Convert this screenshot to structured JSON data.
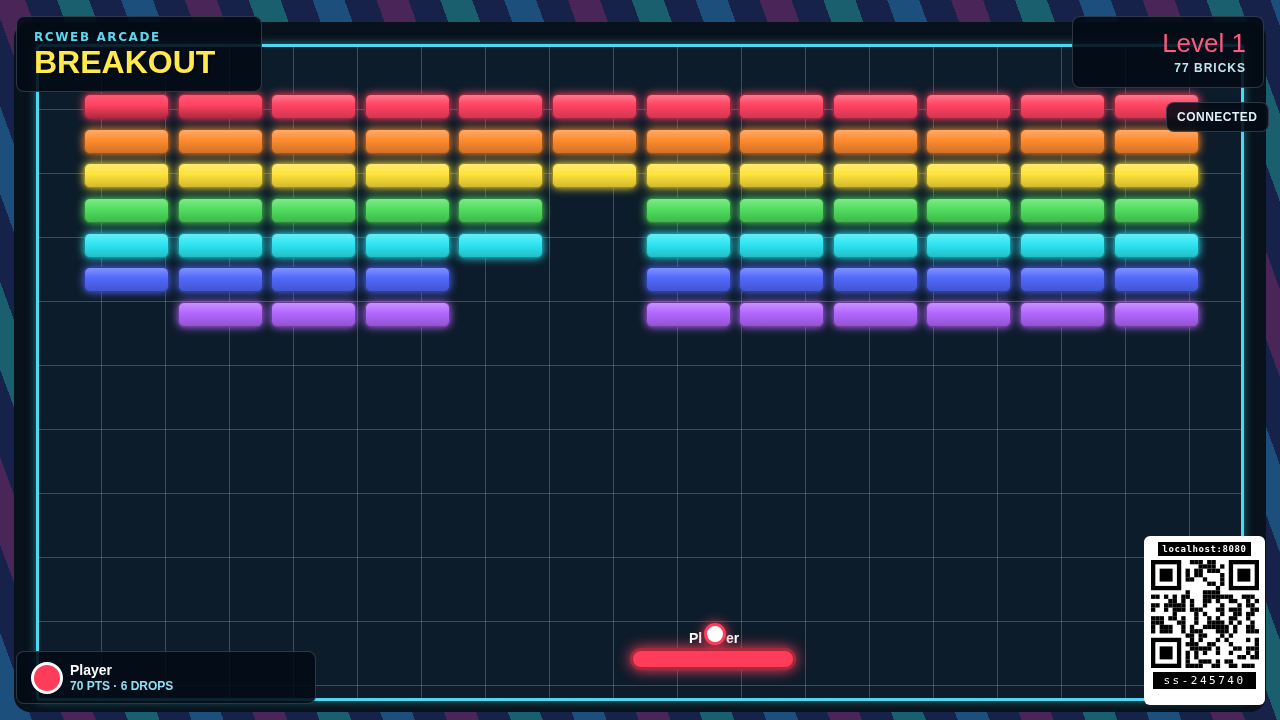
{
  "header": {
    "brand": "RCWEB ARCADE",
    "title": "BREAKOUT"
  },
  "level": {
    "label": "Level 1",
    "count": "77 BRICKS"
  },
  "connection": {
    "label": "CONNECTED"
  },
  "brick_rows": [
    {
      "color": "#ff4262",
      "bricks": [
        {
          "present": true,
          "damaged": true
        },
        {
          "present": true,
          "damaged": true
        },
        {
          "present": true,
          "damaged": false
        },
        {
          "present": true,
          "damaged": false
        },
        {
          "present": true,
          "damaged": false
        },
        {
          "present": true,
          "damaged": false
        },
        {
          "present": true,
          "damaged": false
        },
        {
          "present": true,
          "damaged": false
        },
        {
          "present": true,
          "damaged": false
        },
        {
          "present": true,
          "damaged": false
        },
        {
          "present": true,
          "damaged": false
        },
        {
          "present": true,
          "damaged": false
        }
      ]
    },
    {
      "color": "#ff8a2e",
      "bricks": [
        {
          "present": true,
          "damaged": false
        },
        {
          "present": true,
          "damaged": false
        },
        {
          "present": true,
          "damaged": false
        },
        {
          "present": true,
          "damaged": false
        },
        {
          "present": true,
          "damaged": false
        },
        {
          "present": true,
          "damaged": false
        },
        {
          "present": true,
          "damaged": false
        },
        {
          "present": true,
          "damaged": false
        },
        {
          "present": true,
          "damaged": false
        },
        {
          "present": true,
          "damaged": false
        },
        {
          "present": true,
          "damaged": false
        },
        {
          "present": true,
          "damaged": false
        }
      ]
    },
    {
      "color": "#ffe23a",
      "bricks": [
        {
          "present": true,
          "damaged": false
        },
        {
          "present": true,
          "damaged": false
        },
        {
          "present": true,
          "damaged": false
        },
        {
          "present": true,
          "damaged": false
        },
        {
          "present": true,
          "damaged": false
        },
        {
          "present": true,
          "damaged": false
        },
        {
          "present": true,
          "damaged": false
        },
        {
          "present": true,
          "damaged": false
        },
        {
          "present": true,
          "damaged": false
        },
        {
          "present": true,
          "damaged": false
        },
        {
          "present": true,
          "damaged": false
        },
        {
          "present": true,
          "damaged": false
        }
      ]
    },
    {
      "color": "#4fde5e",
      "bricks": [
        {
          "present": true,
          "damaged": false
        },
        {
          "present": true,
          "damaged": false
        },
        {
          "present": true,
          "damaged": false
        },
        {
          "present": true,
          "damaged": false
        },
        {
          "present": true,
          "damaged": false
        },
        {
          "present": false
        },
        {
          "present": true,
          "damaged": false
        },
        {
          "present": true,
          "damaged": false
        },
        {
          "present": true,
          "damaged": false
        },
        {
          "present": true,
          "damaged": false
        },
        {
          "present": true,
          "damaged": false
        },
        {
          "present": true,
          "damaged": false
        }
      ]
    },
    {
      "color": "#2ce6f2",
      "bricks": [
        {
          "present": true,
          "damaged": false
        },
        {
          "present": true,
          "damaged": false
        },
        {
          "present": true,
          "damaged": false
        },
        {
          "present": true,
          "damaged": false
        },
        {
          "present": true,
          "damaged": false
        },
        {
          "present": false
        },
        {
          "present": true,
          "damaged": false
        },
        {
          "present": true,
          "damaged": false
        },
        {
          "present": true,
          "damaged": false
        },
        {
          "present": true,
          "damaged": false
        },
        {
          "present": true,
          "damaged": false
        },
        {
          "present": true,
          "damaged": false
        }
      ]
    },
    {
      "color": "#5068fc",
      "bricks": [
        {
          "present": true,
          "damaged": false
        },
        {
          "present": true,
          "damaged": false
        },
        {
          "present": true,
          "damaged": false
        },
        {
          "present": true,
          "damaged": false
        },
        {
          "present": false
        },
        {
          "present": false
        },
        {
          "present": true,
          "damaged": false
        },
        {
          "present": true,
          "damaged": false
        },
        {
          "present": true,
          "damaged": false
        },
        {
          "present": true,
          "damaged": false
        },
        {
          "present": true,
          "damaged": false
        },
        {
          "present": true,
          "damaged": false
        }
      ]
    },
    {
      "color": "#b266ff",
      "bricks": [
        {
          "present": false
        },
        {
          "present": true,
          "damaged": false
        },
        {
          "present": true,
          "damaged": false
        },
        {
          "present": true,
          "damaged": false
        },
        {
          "present": false
        },
        {
          "present": false
        },
        {
          "present": true,
          "damaged": false
        },
        {
          "present": true,
          "damaged": false
        },
        {
          "present": true,
          "damaged": false
        },
        {
          "present": true,
          "damaged": false
        },
        {
          "present": true,
          "damaged": false
        },
        {
          "present": true,
          "damaged": false
        }
      ]
    }
  ],
  "paddle": {
    "label_parts": [
      "Pl",
      "er"
    ],
    "color": "#ff3d5a"
  },
  "player": {
    "name": "Player",
    "stats": "70 PTS · 6 DROPS",
    "color": "#ff3d5a"
  },
  "qr": {
    "url": "localhost:8080",
    "code": "ss-245740"
  }
}
